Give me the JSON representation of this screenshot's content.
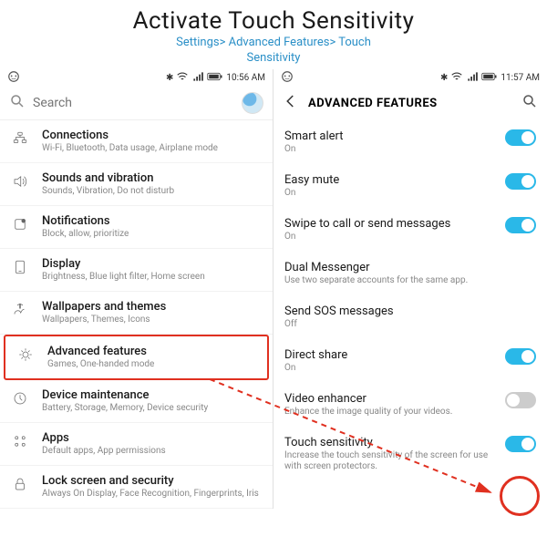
{
  "header": {
    "title": "Activate Touch Sensitivity",
    "breadcrumb_line1": "Settings> Advanced Features> Touch",
    "breadcrumb_line2": "Sensitivity"
  },
  "left_phone": {
    "status": {
      "time": "10:56 AM"
    },
    "search": {
      "placeholder": "Search"
    },
    "items": [
      {
        "icon": "connections",
        "title": "Connections",
        "sub": "Wi-Fi, Bluetooth, Data usage, Airplane mode"
      },
      {
        "icon": "sound",
        "title": "Sounds and vibration",
        "sub": "Sounds, Vibration, Do not disturb"
      },
      {
        "icon": "notif",
        "title": "Notifications",
        "sub": "Block, allow, prioritize"
      },
      {
        "icon": "display",
        "title": "Display",
        "sub": "Brightness, Blue light filter, Home screen"
      },
      {
        "icon": "wallpaper",
        "title": "Wallpapers and themes",
        "sub": "Wallpapers, Themes, Icons"
      },
      {
        "icon": "advanced",
        "title": "Advanced features",
        "sub": "Games, One-handed mode",
        "highlight": true
      },
      {
        "icon": "device",
        "title": "Device maintenance",
        "sub": "Battery, Storage, Memory, Device security"
      },
      {
        "icon": "apps",
        "title": "Apps",
        "sub": "Default apps, App permissions"
      },
      {
        "icon": "lock",
        "title": "Lock screen and security",
        "sub": "Always On Display, Face Recognition, Fingerprints, Iris"
      }
    ]
  },
  "right_phone": {
    "status": {
      "time": "11:57 AM"
    },
    "header": "ADVANCED FEATURES",
    "items": [
      {
        "title": "Smart alert",
        "sub": "On",
        "toggle": true
      },
      {
        "title": "Easy mute",
        "sub": "On",
        "toggle": true
      },
      {
        "title": "Swipe to call or send messages",
        "sub": "On",
        "toggle": true
      },
      {
        "title": "Dual Messenger",
        "sub": "Use two separate accounts for the same app."
      },
      {
        "title": "Send SOS messages",
        "sub": "Off"
      },
      {
        "title": "Direct share",
        "sub": "On",
        "toggle": true
      },
      {
        "title": "Video enhancer",
        "sub": "Enhance the image quality of your videos.",
        "toggle": false
      },
      {
        "title": "Touch sensitivity",
        "sub": "Increase the touch sensitivity of the screen for use with screen protectors.",
        "toggle": true,
        "circle": true
      }
    ]
  }
}
